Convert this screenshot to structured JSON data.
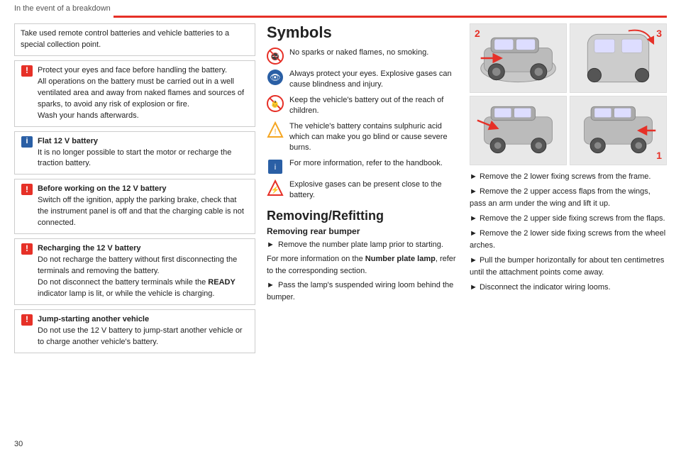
{
  "header": {
    "title": "In the event of a breakdown",
    "accent_color": "#e63027"
  },
  "page_number": "30",
  "left": {
    "battery_notice": "Take used remote control batteries and vehicle batteries to a special collection point.",
    "notices": [
      {
        "type": "warning",
        "title": "",
        "lines": "Protect your eyes and face before handling the battery.\nAll operations on the battery must be carried out in a well ventilated area and away from naked flames and sources of sparks, to avoid any risk of explosion or fire.\nWash your hands afterwards."
      },
      {
        "type": "info",
        "title": "Flat 12 V battery",
        "lines": "It is no longer possible to start the motor or recharge the traction battery."
      },
      {
        "type": "warning",
        "title": "Before working on the 12 V battery",
        "lines": "Switch off the ignition, apply the parking brake, check that the instrument panel is off and that the charging cable is not connected."
      },
      {
        "type": "warning",
        "title": "Recharging the 12 V battery",
        "lines": "Do not recharge the battery without first disconnecting the terminals and removing the battery.\nDo not disconnect the battery terminals while the READY indicator lamp is lit, or while the vehicle is charging."
      },
      {
        "type": "warning",
        "title": "Jump-starting another vehicle",
        "lines": "Do not use the 12 V battery to jump-start another vehicle or to charge another vehicle's battery."
      }
    ]
  },
  "middle": {
    "symbols_title": "Symbols",
    "symbols": [
      {
        "text": "No sparks or naked flames, no smoking."
      },
      {
        "text": "Always protect your eyes. Explosive gases can cause blindness and injury."
      },
      {
        "text": "Keep the vehicle's battery out of the reach of children."
      },
      {
        "text": "The vehicle's battery contains sulphuric acid which can make you go blind or cause severe burns."
      },
      {
        "text": "For more information, refer to the handbook."
      },
      {
        "text": "Explosive gases can be present close to the battery."
      }
    ],
    "removing_title": "Removing/Refitting",
    "removing_subtitle": "Removing rear bumper",
    "steps": [
      "► Remove the number plate lamp prior to starting.",
      "For more information on the Number plate lamp, refer to the corresponding section.",
      "► Pass the lamp's suspended wiring loom behind the bumper."
    ]
  },
  "right": {
    "image_steps": [
      "2",
      "3",
      "1",
      ""
    ],
    "instructions": [
      "► Remove the 2 lower fixing screws from the frame.",
      "► Remove the 2 upper access flaps from the wings, pass an arm under the wing and lift it up.",
      "► Remove the 2 upper side fixing screws from the flaps.",
      "► Remove the 2 lower side fixing screws from the wheel arches.",
      "► Pull the bumper horizontally for about ten centimetres until the attachment points come away.",
      "► Disconnect the indicator wiring looms."
    ]
  }
}
